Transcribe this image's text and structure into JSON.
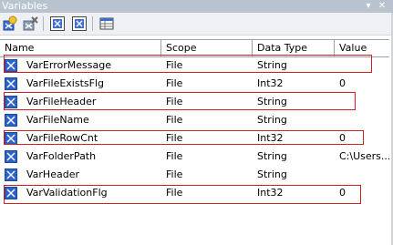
{
  "window": {
    "title": "Variables"
  },
  "toolbar": {
    "buttons": [
      {
        "icon": "add-variable-icon"
      },
      {
        "icon": "delete-variable-icon"
      },
      {
        "icon": "show-system-variables-icon"
      },
      {
        "icon": "show-all-variables-icon"
      },
      {
        "icon": "choose-columns-icon"
      }
    ]
  },
  "grid": {
    "columns": [
      "Name",
      "Scope",
      "Data Type",
      "Value"
    ],
    "rows": [
      {
        "name": "VarErrorMessage",
        "scope": "File",
        "type": "String",
        "value": ""
      },
      {
        "name": "VarFileExistsFlg",
        "scope": "File",
        "type": "Int32",
        "value": "0"
      },
      {
        "name": "VarFileHeader",
        "scope": "File",
        "type": "String",
        "value": ""
      },
      {
        "name": "VarFileName",
        "scope": "File",
        "type": "String",
        "value": ""
      },
      {
        "name": "VarFileRowCnt",
        "scope": "File",
        "type": "Int32",
        "value": "0"
      },
      {
        "name": "VarFolderPath",
        "scope": "File",
        "type": "String",
        "value": "C:\\Users..."
      },
      {
        "name": "VarHeader",
        "scope": "File",
        "type": "String",
        "value": ""
      },
      {
        "name": "VarValidationFlg",
        "scope": "File",
        "type": "Int32",
        "value": "0"
      }
    ]
  },
  "colors": {
    "highlight_border": "#d02020",
    "title_bar": "#b9c3cf",
    "variable_icon": "#2a63c9"
  }
}
